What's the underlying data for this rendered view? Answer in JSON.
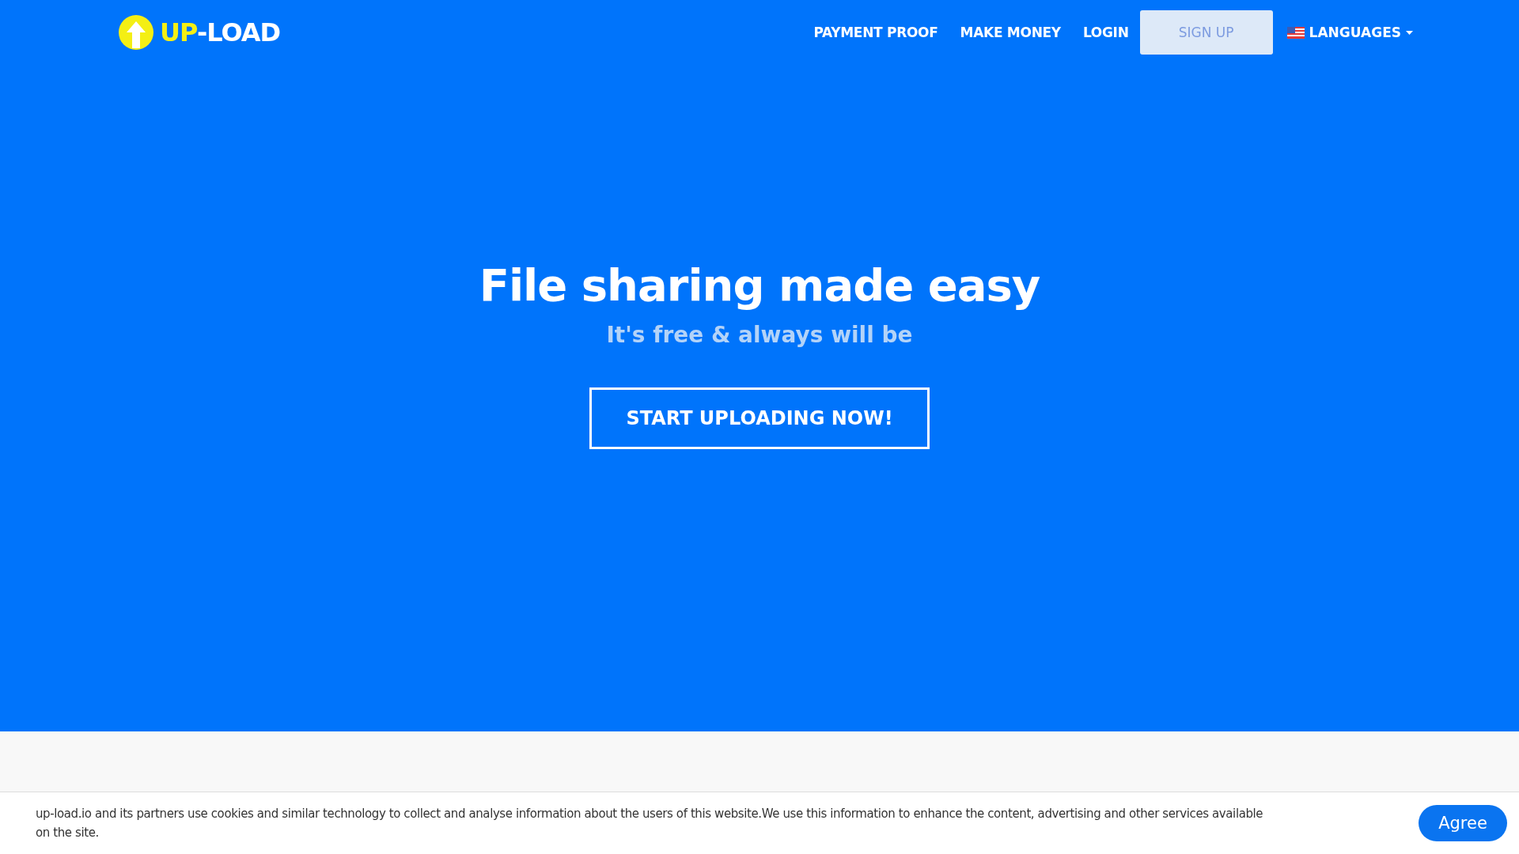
{
  "logo": {
    "accent": "UP",
    "rest": "-LOAD"
  },
  "nav": [
    {
      "kind": "link",
      "label": "PAYMENT PROOF"
    },
    {
      "kind": "link",
      "label": "MAKE MONEY"
    },
    {
      "kind": "link",
      "label": "LOGIN"
    },
    {
      "kind": "button",
      "label": "SIGN UP"
    },
    {
      "kind": "dropdown",
      "label": "LANGUAGES"
    }
  ],
  "hero": {
    "title": "File sharing made easy",
    "subtitle": "It's free & always will be",
    "button": "START UPLOADING NOW!"
  },
  "cookie_bar": {
    "text": "up-load.io and its partners use cookies and similar technology to collect and analyse information about the users of this website.We use this information to enhance the content, advertising and other services available on the site.",
    "button": "Agree"
  }
}
